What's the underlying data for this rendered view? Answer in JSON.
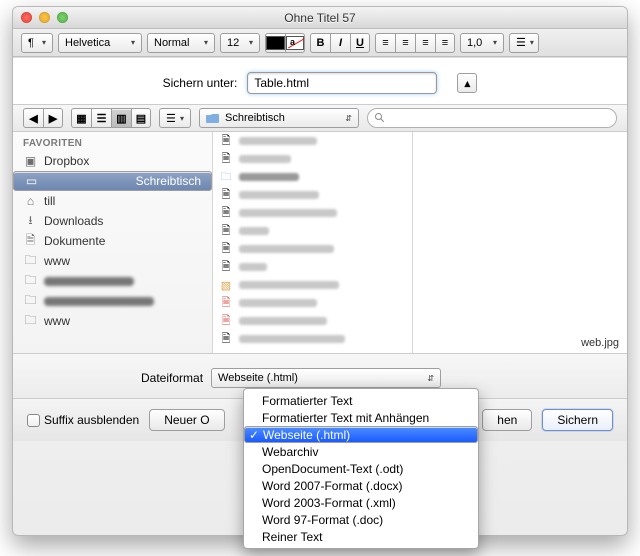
{
  "window": {
    "title": "Ohne Titel 57"
  },
  "toolbar": {
    "para_symbol": "¶",
    "font_family": "Helvetica",
    "font_style": "Normal",
    "font_size": "12",
    "bold": "B",
    "italic": "I",
    "underline": "U",
    "spacing": "1,0"
  },
  "save": {
    "label": "Sichern unter:",
    "filename": "Table.html",
    "collapse_glyph": "▴"
  },
  "nav": {
    "back": "◀",
    "forward": "▶",
    "location": "Schreibtisch"
  },
  "sidebar": {
    "header": "FAVORITEN",
    "items": [
      {
        "label": "Dropbox"
      },
      {
        "label": "Schreibtisch"
      },
      {
        "label": "till"
      },
      {
        "label": "Downloads"
      },
      {
        "label": "Dokumente"
      },
      {
        "label": "www"
      },
      {
        "label": ""
      },
      {
        "label": ""
      },
      {
        "label": "www"
      }
    ],
    "selected_index": 1
  },
  "filelist_caption": "web.jpg",
  "format": {
    "label": "Dateiformat",
    "options": [
      "Formatierter Text",
      "Formatierter Text mit Anhängen",
      "Webseite (.html)",
      "Webarchiv",
      "OpenDocument-Text (.odt)",
      "Word 2007-Format (.docx)",
      "Word 2003-Format (.xml)",
      "Word 97-Format (.doc)",
      "Reiner Text"
    ],
    "selected_index": 2
  },
  "footer": {
    "hide_suffix": "Suffix ausblenden",
    "new_folder": "Neuer O",
    "cancel_fragment": "hen",
    "save": "Sichern"
  }
}
